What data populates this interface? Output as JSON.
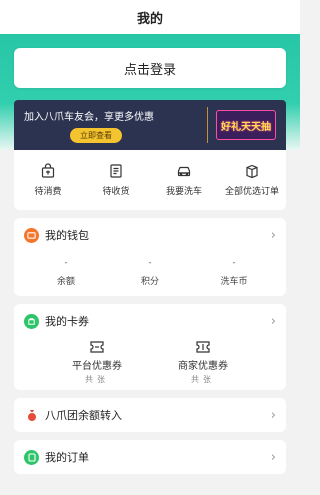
{
  "nav": {
    "title": "我的"
  },
  "login": {
    "label": "点击登录"
  },
  "promo": {
    "text": "加入八爪车友会，享更多优惠",
    "button": "立即查看",
    "badge": "好礼天天抽"
  },
  "orders": [
    {
      "label": "待消费",
      "icon": "shopping-bag-icon"
    },
    {
      "label": "待收货",
      "icon": "receipt-icon"
    },
    {
      "label": "我要洗车",
      "icon": "car-icon"
    },
    {
      "label": "全部优选订单",
      "icon": "package-icon"
    }
  ],
  "wallet": {
    "title": "我的钱包",
    "icon_color": "#f5762b",
    "stats": [
      {
        "value": "-",
        "label": "余额"
      },
      {
        "value": "-",
        "label": "积分"
      },
      {
        "value": "-",
        "label": "洗车币"
      }
    ]
  },
  "cards": {
    "title": "我的卡券",
    "icon_color": "#2dc46a",
    "items": [
      {
        "label": "平台优惠券",
        "count": "共张",
        "icon": "ticket-icon"
      },
      {
        "label": "商家优惠券",
        "count": "共张",
        "icon": "coupon-icon"
      }
    ]
  },
  "transfer": {
    "title": "八爪团余额转入",
    "icon_color": "#e84a3a"
  },
  "myorders": {
    "title": "我的订单",
    "icon_color": "#2dc46a"
  },
  "colors": {
    "accent": "#27c6a6",
    "promo_bg": "#2b3350",
    "promo_btn": "#f4c430"
  }
}
